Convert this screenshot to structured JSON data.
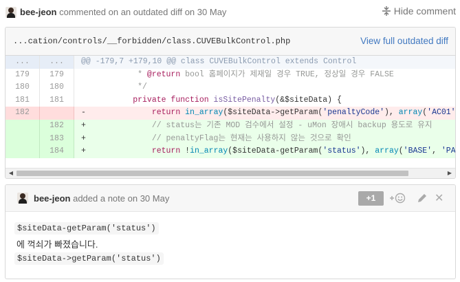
{
  "comment": {
    "author": "bee-jeon",
    "action": "commented on an outdated diff on",
    "date": "30 May",
    "hide_label": "Hide comment"
  },
  "diff": {
    "file_path": "...cation/controls/__forbidden/class.CUVEBulkControl.php",
    "view_link": "View full outdated diff",
    "hunk": {
      "n1": "...",
      "n2": "...",
      "text": "@@ -179,7 +179,10 @@ class CUVEBulkControl extends Control"
    },
    "lines": [
      {
        "n1": "179",
        "n2": "179",
        "type": "ctx",
        "sign": " ",
        "segments": [
          {
            "c": "cm",
            "t": "         * "
          },
          {
            "c": "doctag",
            "t": "@return"
          },
          {
            "c": "cm",
            "t": " bool 홈페이지가 제재일 경우 TRUE, 정상일 경우 FALSE"
          }
        ]
      },
      {
        "n1": "180",
        "n2": "180",
        "type": "ctx",
        "sign": " ",
        "segments": [
          {
            "c": "cm",
            "t": "         */"
          }
        ]
      },
      {
        "n1": "181",
        "n2": "181",
        "type": "ctx",
        "sign": " ",
        "segments": [
          {
            "c": "",
            "t": "        "
          },
          {
            "c": "kw",
            "t": "private function"
          },
          {
            "c": "",
            "t": " "
          },
          {
            "c": "fn",
            "t": "isSitePenalty"
          },
          {
            "c": "",
            "t": "(&$siteData) {"
          }
        ]
      },
      {
        "n1": "182",
        "n2": "",
        "type": "del",
        "sign": "-",
        "segments": [
          {
            "c": "",
            "t": "            "
          },
          {
            "c": "kw",
            "t": "return"
          },
          {
            "c": "",
            "t": " "
          },
          {
            "c": "bi",
            "t": "in_array"
          },
          {
            "c": "",
            "t": "($siteData->getParam("
          },
          {
            "c": "st",
            "t": "'penaltyCode'"
          },
          {
            "c": "",
            "t": "), "
          },
          {
            "c": "bi",
            "t": "array"
          },
          {
            "c": "",
            "t": "("
          },
          {
            "c": "st",
            "t": "'AC01'"
          },
          {
            "c": "",
            "t": ", "
          },
          {
            "c": "st",
            "t": "'"
          }
        ]
      },
      {
        "n1": "",
        "n2": "182",
        "type": "add",
        "sign": "+",
        "segments": [
          {
            "c": "",
            "t": "            "
          },
          {
            "c": "cm",
            "t": "// status는 기존 MOD 검수에서 설정 - uMon 장애시 backup 용도로 유지"
          }
        ]
      },
      {
        "n1": "",
        "n2": "183",
        "type": "add",
        "sign": "+",
        "segments": [
          {
            "c": "",
            "t": "            "
          },
          {
            "c": "cm",
            "t": "// penaltyFlag는 현재는 사용하지 않는 것으로 확인"
          }
        ]
      },
      {
        "n1": "",
        "n2": "184",
        "type": "add",
        "sign": "+",
        "segments": [
          {
            "c": "",
            "t": "            "
          },
          {
            "c": "kw",
            "t": "return"
          },
          {
            "c": "",
            "t": " !"
          },
          {
            "c": "bi",
            "t": "in_array"
          },
          {
            "c": "",
            "t": "($siteData-getParam("
          },
          {
            "c": "st",
            "t": "'status'"
          },
          {
            "c": "",
            "t": "), "
          },
          {
            "c": "bi",
            "t": "array"
          },
          {
            "c": "",
            "t": "("
          },
          {
            "c": "st",
            "t": "'BASE'"
          },
          {
            "c": "",
            "t": ", "
          },
          {
            "c": "st",
            "t": "'PASS'"
          }
        ]
      }
    ]
  },
  "note": {
    "author": "bee-jeon",
    "action": "added a note on",
    "date": "30 May",
    "plus_one": "+1",
    "body_code_1": "$siteData-getParam('status')",
    "body_text": "에 꺽쇠가 빠졌습니다.",
    "body_code_2": "$siteData->getParam('status')"
  },
  "icons": {
    "hide": "hide-comment-icon",
    "reaction": "add-reaction-icon",
    "edit": "pencil-icon",
    "close": "close-icon"
  }
}
